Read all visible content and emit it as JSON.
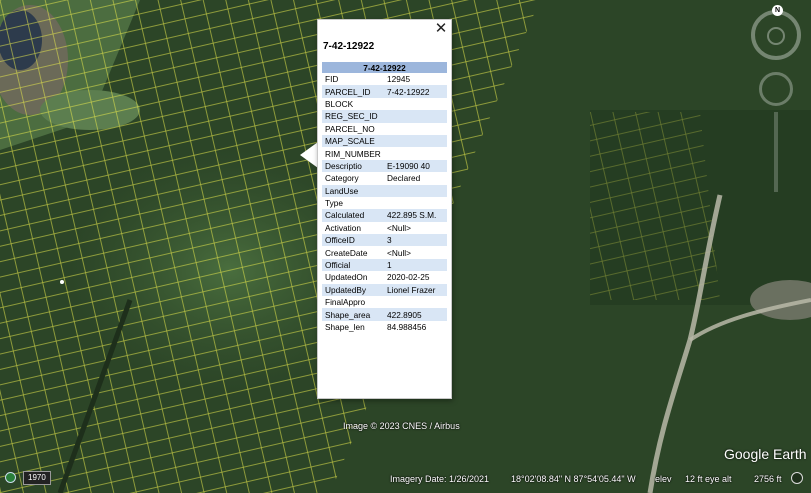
{
  "balloon": {
    "title": "7-42-12922",
    "table_header": "7-42-12922",
    "rows": [
      {
        "field": "FID",
        "value": "12945"
      },
      {
        "field": "PARCEL_ID",
        "value": "7-42-12922"
      },
      {
        "field": "BLOCK",
        "value": ""
      },
      {
        "field": "REG_SEC_ID",
        "value": ""
      },
      {
        "field": "PARCEL_NO",
        "value": ""
      },
      {
        "field": "MAP_SCALE",
        "value": ""
      },
      {
        "field": "RIM_NUMBER",
        "value": ""
      },
      {
        "field": "Descriptio",
        "value": "E-19090 40"
      },
      {
        "field": "Category",
        "value": "Declared"
      },
      {
        "field": "LandUse",
        "value": ""
      },
      {
        "field": "Type",
        "value": ""
      },
      {
        "field": "Calculated",
        "value": "422.895 S.M."
      },
      {
        "field": "Activation",
        "value": "<Null>"
      },
      {
        "field": "OfficeID",
        "value": "3"
      },
      {
        "field": "CreateDate",
        "value": "<Null>"
      },
      {
        "field": "Official",
        "value": "1"
      },
      {
        "field": "UpdatedOn",
        "value": "2020-02-25"
      },
      {
        "field": "UpdatedBy",
        "value": "Lionel Frazer"
      },
      {
        "field": "FinalAppro",
        "value": ""
      },
      {
        "field": "Shape_area",
        "value": "422.8905"
      },
      {
        "field": "Shape_len",
        "value": "84.988456"
      }
    ],
    "close_icon": "close-icon"
  },
  "status_bar": {
    "attribution": "Image © 2023 CNES / Airbus",
    "imagery_date": "Imagery Date: 1/26/2021",
    "coordinates": "18°02'08.84\" N    87°54'05.44\" W",
    "elev_label": "elev",
    "elev_value": "12 ft",
    "eye_alt_label": "eye alt",
    "eye_alt_value": "2756 ft"
  },
  "logo": "Google Earth",
  "timeline": {
    "year": "1970"
  },
  "nav": {
    "north": "N"
  },
  "colors": {
    "parcel_lines": "#e7e84a",
    "table_header": "#9cb6dc",
    "table_stripe": "#d9e6f5"
  }
}
